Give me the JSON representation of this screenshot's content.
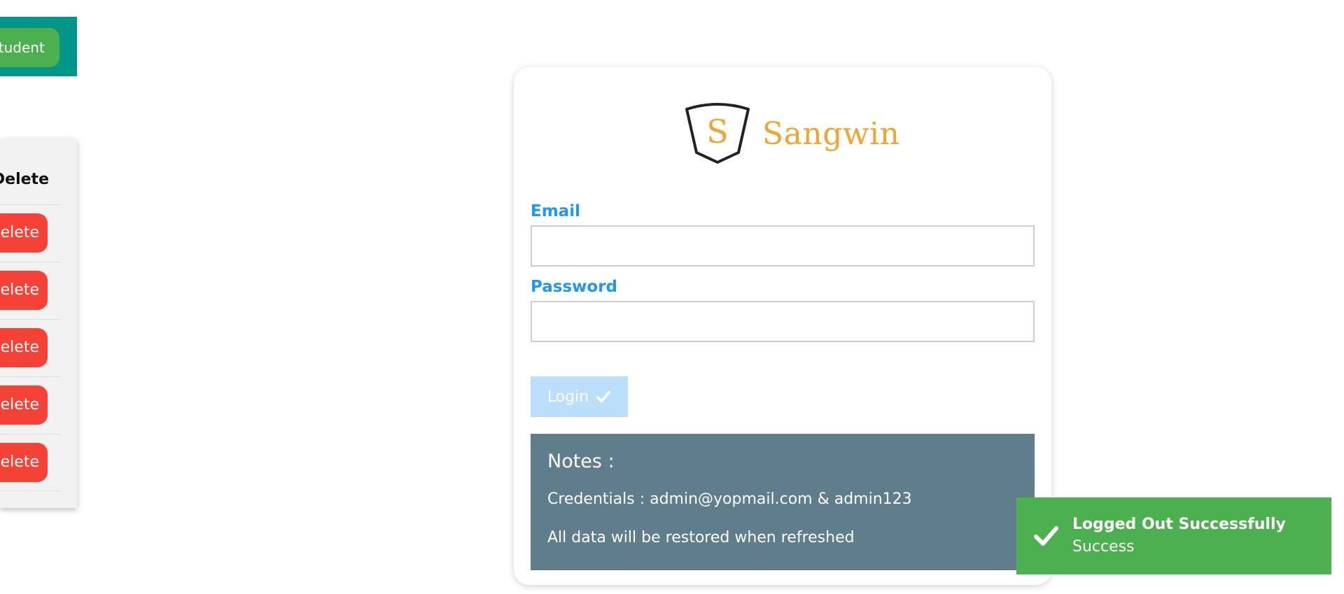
{
  "background_page": {
    "add_student_label": "Add Student",
    "table": {
      "delete_column_header": "Delete",
      "rows": [
        {
          "delete_label": "Delete"
        },
        {
          "delete_label": "Delete"
        },
        {
          "delete_label": "Delete"
        },
        {
          "delete_label": "Delete"
        },
        {
          "delete_label": "Delete"
        }
      ]
    }
  },
  "login": {
    "logo_letter": "S",
    "logo_text": "Sangwin",
    "email_label": "Email",
    "email_value": "",
    "password_label": "Password",
    "password_value": "",
    "login_button_label": "Login",
    "login_icon": "check-icon",
    "notes": {
      "title": "Notes :",
      "credentials": "Credentials : admin@yopmail.com & admin123",
      "restore_info": "All data will be restored when refreshed"
    }
  },
  "toast": {
    "title": "Logged Out Successfully",
    "message": "Success",
    "icon": "check-icon"
  },
  "colors": {
    "teal_bar": "#009688",
    "success_green": "#4caf50",
    "delete_red": "#f44336",
    "label_blue": "#2196f3",
    "login_disabled": "#bbdefb",
    "notes_bg": "#607d8b",
    "logo_orange": "#f0a434"
  }
}
